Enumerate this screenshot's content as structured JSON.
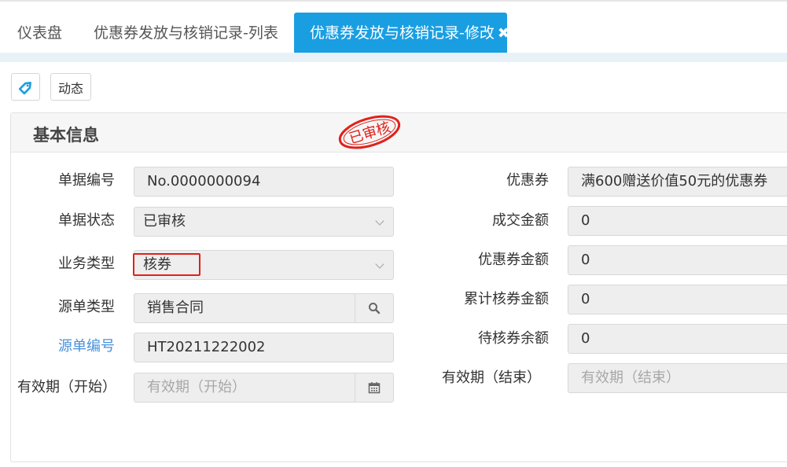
{
  "tabs": [
    {
      "label": "仪表盘"
    },
    {
      "label": "优惠券发放与核销记录-列表"
    },
    {
      "label": "优惠券发放与核销记录-修改",
      "close": "✖"
    }
  ],
  "toolbar": {
    "tag_icon": "tag-icon",
    "dynamic_label": "动态"
  },
  "panel": {
    "title": "基本信息",
    "stamp": "已审核"
  },
  "left_form": {
    "doc_no_label": "单据编号",
    "doc_no_value": "No.0000000094",
    "status_label": "单据状态",
    "status_value": "已审核",
    "biz_type_label": "业务类型",
    "biz_type_value": "核券",
    "source_type_label": "源单类型",
    "source_type_value": "销售合同",
    "source_no_label": "源单编号",
    "source_no_value": "HT20211222002",
    "valid_start_label": "有效期（开始）",
    "valid_start_placeholder": "有效期（开始）"
  },
  "right_form": {
    "coupon_label": "优惠券",
    "coupon_value": "满600赠送价值50元的优惠券",
    "deal_amount_label": "成交金额",
    "deal_amount_value": "0",
    "coupon_amount_label": "优惠券金额",
    "coupon_amount_value": "0",
    "total_redeemed_label": "累计核券金额",
    "total_redeemed_value": "0",
    "pending_balance_label": "待核券余额",
    "pending_balance_value": "0",
    "valid_end_label": "有效期（结束）",
    "valid_end_placeholder": "有效期（结束）"
  },
  "colors": {
    "accent": "#1a9ee2",
    "stamp": "#e0211b",
    "link": "#4a90d9"
  }
}
